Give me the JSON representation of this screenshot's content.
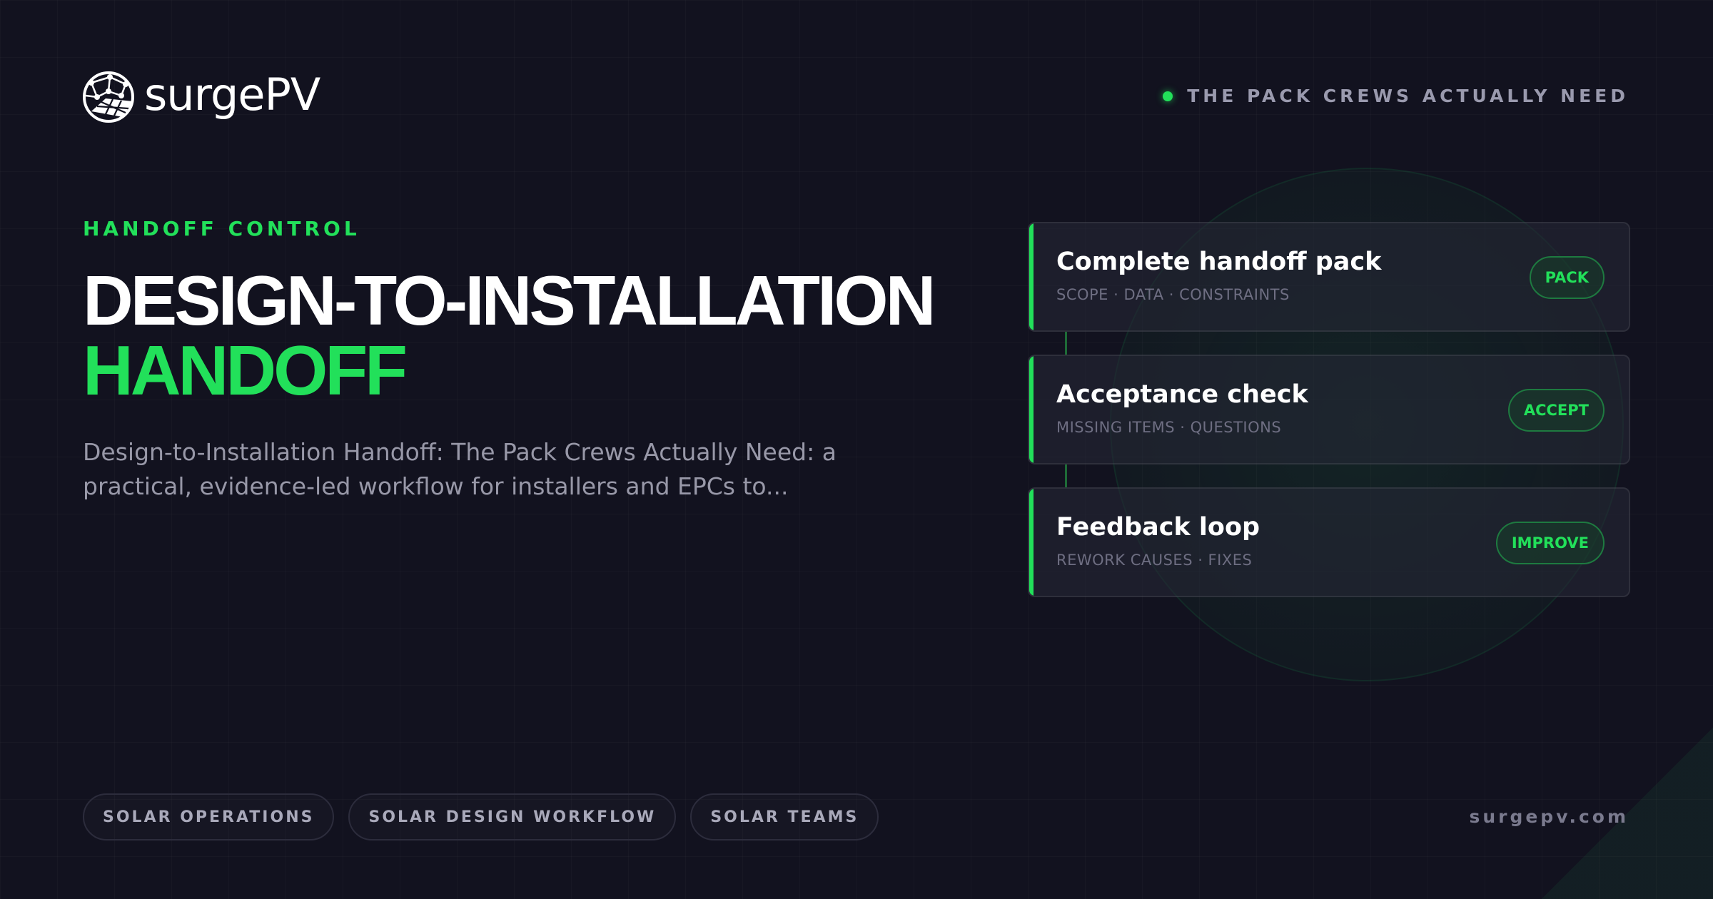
{
  "brand": {
    "logo_text": "surgePV",
    "logo_icon": "globe-grid-icon",
    "website": "surgepv.com"
  },
  "tagline": "THE PACK CREWS ACTUALLY NEED",
  "eyebrow": "HANDOFF CONTROL",
  "title": {
    "line1": "DESIGN-TO-INSTALLATION",
    "line2": "HANDOFF"
  },
  "description": "Design-to-Installation Handoff: The Pack Crews Actually Need: a practical, evidence-led workflow for installers and EPCs to...",
  "tags": [
    "SOLAR OPERATIONS",
    "SOLAR DESIGN WORKFLOW",
    "SOLAR TEAMS"
  ],
  "steps": [
    {
      "title": "Complete handoff pack",
      "subtitle": "SCOPE · DATA · CONSTRAINTS",
      "badge": "PACK"
    },
    {
      "title": "Acceptance check",
      "subtitle": "MISSING ITEMS · QUESTIONS",
      "badge": "ACCEPT"
    },
    {
      "title": "Feedback loop",
      "subtitle": "REWORK CAUSES · FIXES",
      "badge": "IMPROVE"
    }
  ],
  "colors": {
    "background": "#12121f",
    "accent": "#22e05a",
    "muted_text": "#9898a8"
  }
}
